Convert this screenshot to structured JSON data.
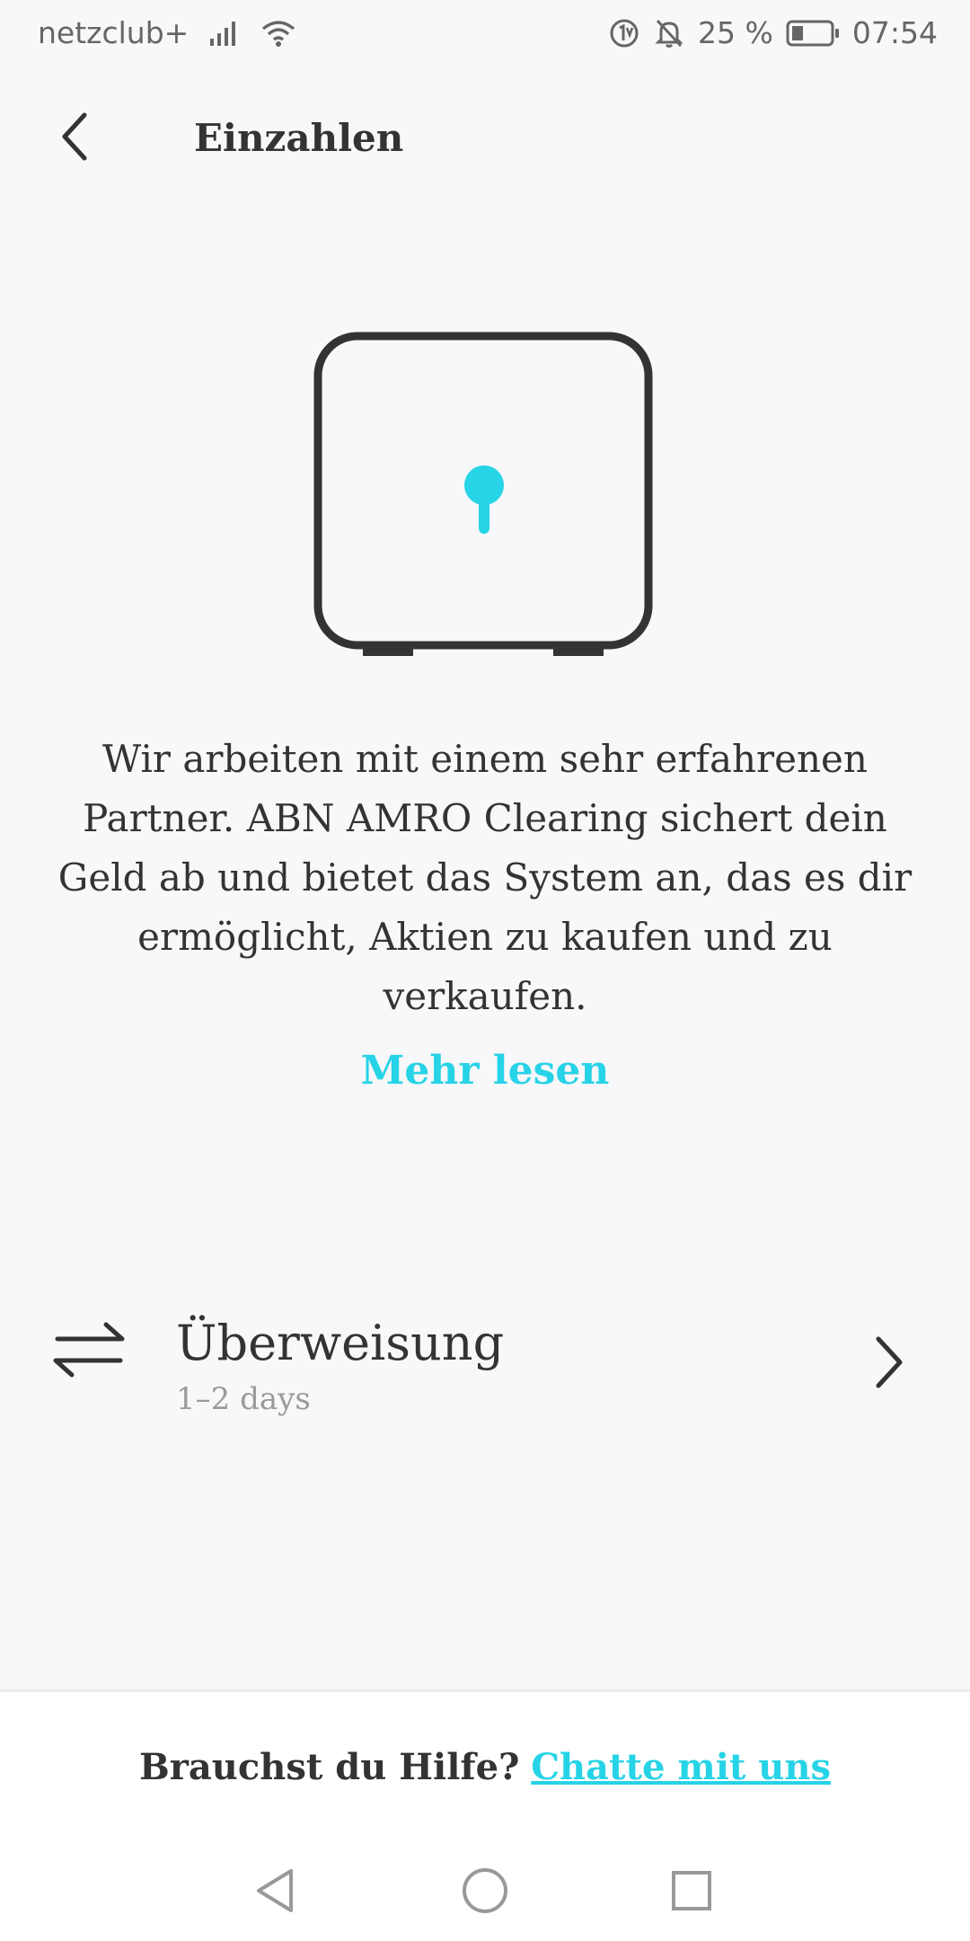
{
  "status_bar": {
    "carrier": "netzclub+",
    "battery_percent": "25 %",
    "time": "07:54",
    "icons": [
      "signal-icon",
      "wifi-icon",
      "data-saver-icon",
      "mute-icon",
      "battery-icon"
    ]
  },
  "header": {
    "title": "Einzahlen",
    "back_icon": "back-arrow-icon"
  },
  "illustration": {
    "icon": "safe-keyhole-icon",
    "accent_color": "#27d3e6"
  },
  "info": {
    "description": "Wir arbeiten mit einem sehr erfahrenen Partner. ABN AMRO Clearing sichert dein Geld ab und bietet das System an, das es dir ermöglicht, Aktien zu kaufen und zu verkaufen.",
    "read_more": "Mehr lesen"
  },
  "payment_methods": [
    {
      "title": "Überweisung",
      "subtitle": "1–2 days",
      "icon": "transfer-arrows-icon"
    }
  ],
  "footer": {
    "help_text": "Brauchst du Hilfe?",
    "chat_link": "Chatte mit uns"
  },
  "nav_bar": {
    "icons": [
      "back-triangle-icon",
      "home-circle-icon",
      "recents-square-icon"
    ]
  },
  "colors": {
    "accent": "#27d3e6",
    "text": "#333333",
    "muted": "#9a9a9a",
    "background": "#f8f7f9"
  }
}
